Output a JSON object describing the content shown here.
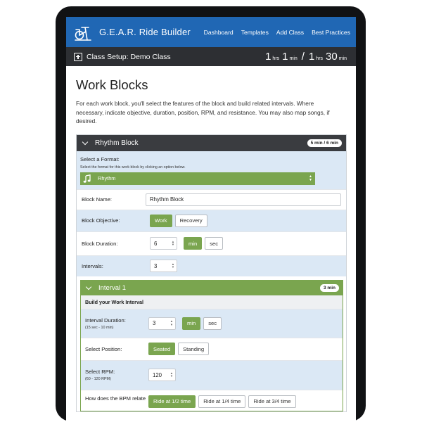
{
  "app": {
    "brand": "G.E.A.R. Ride Builder",
    "nav": [
      "Dashboard",
      "Templates",
      "Add Class",
      "Best Practices"
    ]
  },
  "setup": {
    "title": "Class Setup: Demo Class",
    "duration": {
      "used_hrs": "1",
      "used_min": "1",
      "total_hrs": "1",
      "total_min": "30",
      "hrs_unit": "hrs",
      "min_unit": "min",
      "separator": "/"
    }
  },
  "page": {
    "title": "Work Blocks",
    "intro": "For each work block, you'll select the features of the block and build related intervals. Where necessary, indicate objective, duration, position, RPM, and resistance. You may also map songs, if desired."
  },
  "block": {
    "title": "Rhythm Block",
    "badge": "5 min / 6 min",
    "format_label": "Select a Format:",
    "format_hint": "Select the format for this work block by clicking an option below.",
    "format_value": "Rhythm",
    "name_label": "Block Name:",
    "name_value": "Rhythm Block",
    "objective_label": "Block Objective:",
    "objective_options": [
      "Work",
      "Recovery"
    ],
    "duration_label": "Block Duration:",
    "duration_value": "6",
    "unit_options": [
      "min",
      "sec"
    ],
    "intervals_label": "Intervals:",
    "intervals_value": "3"
  },
  "interval": {
    "title": "Interval 1",
    "badge": "3 min",
    "subhead": "Build your Work Interval",
    "duration_label": "Interval Duration:",
    "duration_hint": "(15 sec - 10 min)",
    "duration_value": "3",
    "unit_options": [
      "min",
      "sec"
    ],
    "position_label": "Select Position:",
    "position_options": [
      "Seated",
      "Standing"
    ],
    "rpm_label": "Select RPM:",
    "rpm_hint": "(60 - 120 RPM)",
    "rpm_value": "120",
    "bpm_label": "How does the BPM relate",
    "bpm_options": [
      "Ride at 1/2 time",
      "Ride at 1/4 time",
      "Ride at 3/4 time"
    ]
  },
  "colors": {
    "navbar": "#2067b4",
    "setupbar": "#2d2f33",
    "accent_green": "#7aa54f",
    "row_blue": "#dbe8f5"
  },
  "icons": [
    "stationary-bike-icon",
    "plus-square-icon",
    "chevron-down-icon",
    "music-note-icon"
  ]
}
